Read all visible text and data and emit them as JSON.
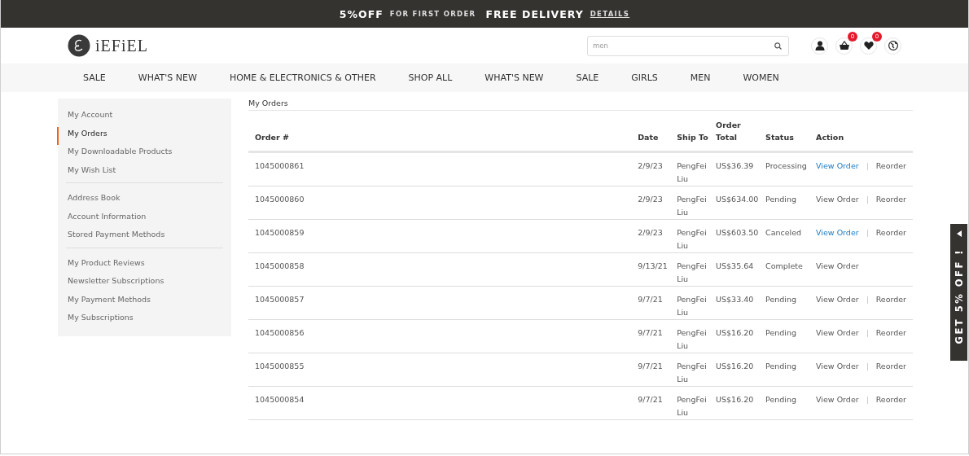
{
  "promo_bar": {
    "offer": "5%OFF",
    "offer_note": "FOR FIRST ORDER",
    "delivery": "FREE DELIVERY",
    "details_link": "DETAILS"
  },
  "header": {
    "logo_text": "iEFiEL",
    "search": {
      "value": "men"
    },
    "cart_count": "0",
    "wishlist_count": "0"
  },
  "nav": [
    "SALE",
    "WHAT'S NEW",
    "HOME & ELECTRONICS & OTHER",
    "SHOP ALL",
    "WHAT'S NEW",
    "SALE",
    "GIRLS",
    "MEN",
    "WOMEN"
  ],
  "sidebar": {
    "groups": [
      [
        {
          "label": "My Account",
          "selected": false
        },
        {
          "label": "My Orders",
          "selected": true
        },
        {
          "label": "My Downloadable Products",
          "selected": false
        },
        {
          "label": "My Wish List",
          "selected": false
        }
      ],
      [
        {
          "label": "Address Book",
          "selected": false
        },
        {
          "label": "Account Information",
          "selected": false
        },
        {
          "label": "Stored Payment Methods",
          "selected": false
        }
      ],
      [
        {
          "label": "My Product Reviews",
          "selected": false
        },
        {
          "label": "Newsletter Subscriptions",
          "selected": false
        },
        {
          "label": "My Payment Methods",
          "selected": false
        },
        {
          "label": "My Subscriptions",
          "selected": false
        }
      ]
    ]
  },
  "page_title": "My Orders",
  "table": {
    "columns": [
      "Order #",
      "Date",
      "Ship To",
      "Order Total",
      "Status",
      "Action"
    ],
    "rows": [
      {
        "order": "1045000861",
        "date": "2/9/23",
        "ship_to": "PengFei Liu",
        "total": "US$36.39",
        "status": "Processing",
        "view": "View Order",
        "view_highlighted": true,
        "reorder": "Reorder"
      },
      {
        "order": "1045000860",
        "date": "2/9/23",
        "ship_to": "PengFei Liu",
        "total": "US$634.00",
        "status": "Pending",
        "view": "View Order",
        "view_highlighted": false,
        "reorder": "Reorder"
      },
      {
        "order": "1045000859",
        "date": "2/9/23",
        "ship_to": "PengFei Liu",
        "total": "US$603.50",
        "status": "Canceled",
        "view": "View Order",
        "view_highlighted": true,
        "reorder": "Reorder"
      },
      {
        "order": "1045000858",
        "date": "9/13/21",
        "ship_to": "PengFei Liu",
        "total": "US$35.64",
        "status": "Complete",
        "view": "View Order",
        "view_highlighted": false
      },
      {
        "order": "1045000857",
        "date": "9/7/21",
        "ship_to": "PengFei Liu",
        "total": "US$33.40",
        "status": "Pending",
        "view": "View Order",
        "view_highlighted": false,
        "reorder": "Reorder"
      },
      {
        "order": "1045000856",
        "date": "9/7/21",
        "ship_to": "PengFei Liu",
        "total": "US$16.20",
        "status": "Pending",
        "view": "View Order",
        "view_highlighted": false,
        "reorder": "Reorder"
      },
      {
        "order": "1045000855",
        "date": "9/7/21",
        "ship_to": "PengFei Liu",
        "total": "US$16.20",
        "status": "Pending",
        "view": "View Order",
        "view_highlighted": false,
        "reorder": "Reorder"
      },
      {
        "order": "1045000854",
        "date": "9/7/21",
        "ship_to": "PengFei Liu",
        "total": "US$16.20",
        "status": "Pending",
        "view": "View Order",
        "view_highlighted": false,
        "reorder": "Reorder"
      }
    ]
  },
  "side_tab": {
    "label": "GET 5% OFF !"
  }
}
